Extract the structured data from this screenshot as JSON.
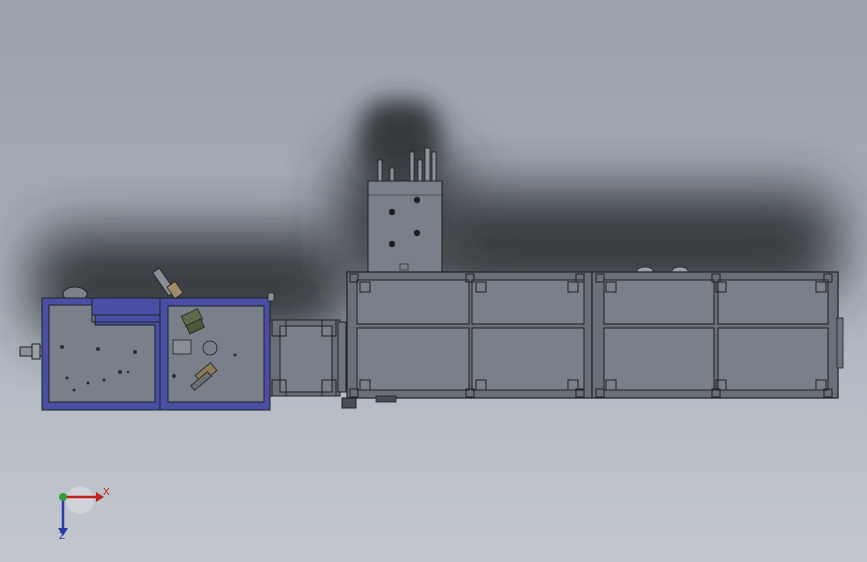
{
  "viewport": {
    "background_top": "#9aa2ad",
    "background_bottom": "#c3c8cf"
  },
  "colors": {
    "frame_blue": "#4a4fa6",
    "panel_gray": "#7a8089",
    "panel_dark": "#6a7079",
    "edge_black": "#1e2024",
    "shadow": "#2a2d33",
    "corner_bracket": "#3a3d44"
  },
  "triad": {
    "x_label": "X",
    "z_label": "Z",
    "x_color": "#c41f1f",
    "y_color": "#2f9e3a",
    "z_color": "#2b3aa8"
  }
}
